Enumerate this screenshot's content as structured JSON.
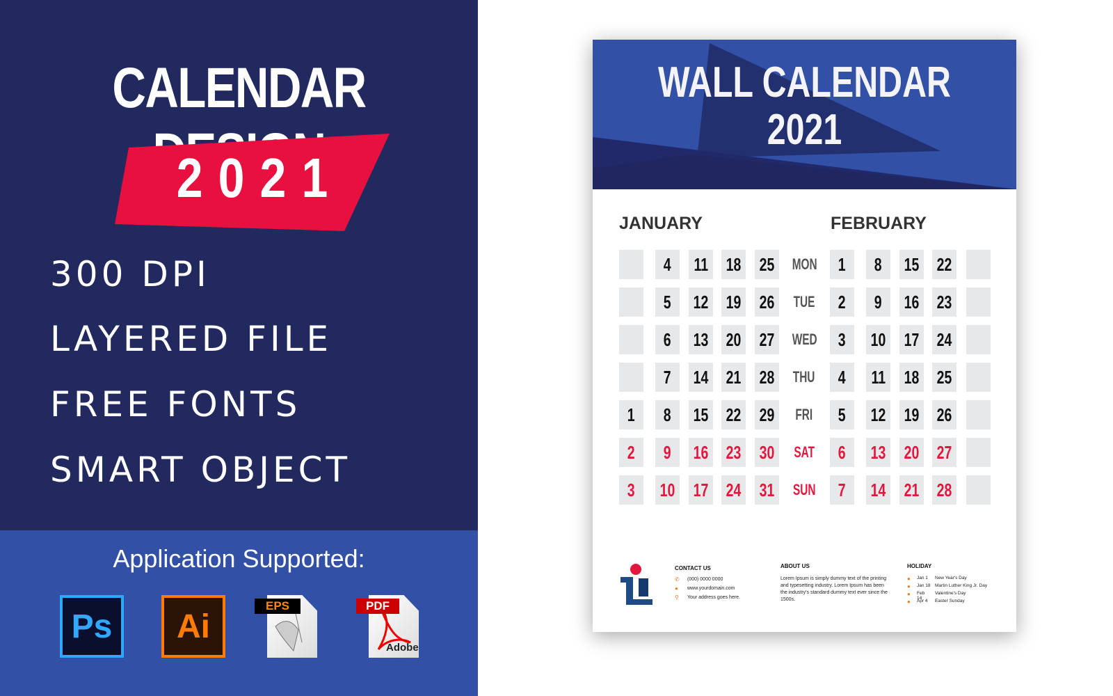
{
  "promo": {
    "title": "CALENDAR DESIGN",
    "year": "2021",
    "features": [
      "300 DPI",
      "LAYERED FILE",
      "FREE FONTS",
      "SMART OBJECT"
    ],
    "apps_label": "Application Supported:",
    "apps": [
      {
        "name": "photoshop-icon",
        "label": "Ps"
      },
      {
        "name": "illustrator-icon",
        "label": "Ai"
      },
      {
        "name": "eps-file-icon",
        "label": "EPS"
      },
      {
        "name": "pdf-file-icon",
        "label": "PDF",
        "sub": "Adobe"
      }
    ],
    "colors": {
      "navy": "#21295f",
      "blue": "#3250a5",
      "red": "#e8103f"
    }
  },
  "calendar": {
    "title": "WALL CALENDAR",
    "year": "2021",
    "weekdays": [
      "MON",
      "TUE",
      "WED",
      "THU",
      "FRI",
      "SAT",
      "SUN"
    ],
    "weekend_color": "#e3173e",
    "months": [
      {
        "name": "JANUARY",
        "columns": [
          [
            "",
            "",
            "",
            "",
            "1",
            "2",
            "3"
          ],
          [
            "4",
            "5",
            "6",
            "7",
            "8",
            "9",
            "10"
          ],
          [
            "11",
            "12",
            "13",
            "14",
            "15",
            "16",
            "17"
          ],
          [
            "18",
            "19",
            "20",
            "21",
            "22",
            "23",
            "24"
          ],
          [
            "25",
            "26",
            "27",
            "28",
            "29",
            "30",
            "31"
          ]
        ]
      },
      {
        "name": "FEBRUARY",
        "columns": [
          [
            "1",
            "2",
            "3",
            "4",
            "5",
            "6",
            "7"
          ],
          [
            "8",
            "9",
            "10",
            "11",
            "12",
            "13",
            "14"
          ],
          [
            "15",
            "16",
            "17",
            "18",
            "19",
            "20",
            "21"
          ],
          [
            "22",
            "23",
            "24",
            "25",
            "26",
            "27",
            "28"
          ],
          [
            "",
            "",
            "",
            "",
            "",
            "",
            ""
          ]
        ]
      }
    ],
    "footer": {
      "contact": {
        "heading": "CONTACT US",
        "phone": "(000) 0000 0000",
        "web": "www.yourdomain.com",
        "address": "Your address goes here."
      },
      "about": {
        "heading": "ABOUT US",
        "text": "Lorem Ipsum is simply dummy text of the printing and typesetting industry. Lorem Ipsum has been the industry's standard dummy text ever since the 1500s."
      },
      "holiday": {
        "heading": "HOLIDAY",
        "items": [
          {
            "date": "Jan 1",
            "name": "New Year's Day"
          },
          {
            "date": "Jan 18",
            "name": "Martin Luther King Jr. Day"
          },
          {
            "date": "Feb 14",
            "name": "Valentine's Day"
          },
          {
            "date": "Apr 4",
            "name": "Easter Sunday"
          }
        ]
      }
    }
  }
}
